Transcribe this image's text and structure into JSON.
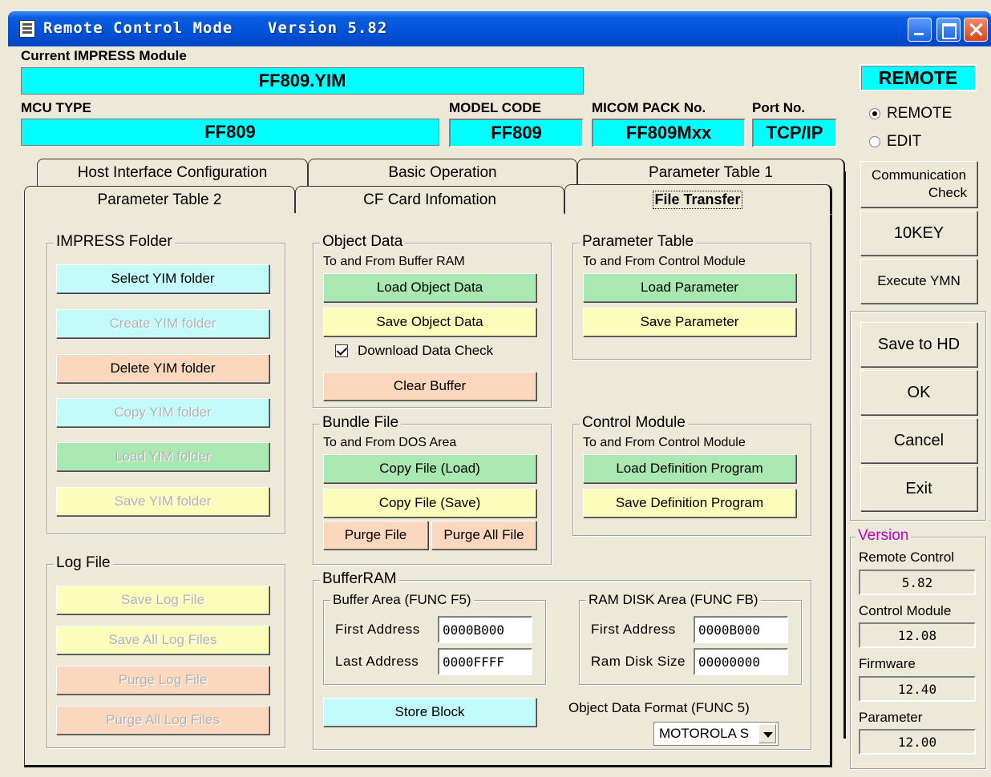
{
  "window": {
    "title": "Remote Control Mode",
    "version_label": "Version  5.82"
  },
  "module": {
    "label": "Current IMPRESS Module",
    "value": "FF809.YIM"
  },
  "mcu": {
    "label": "MCU TYPE",
    "value": "FF809"
  },
  "model": {
    "label": "MODEL CODE",
    "value": "FF809"
  },
  "micom": {
    "label": "MICOM PACK No.",
    "value": "FF809Mxx"
  },
  "port": {
    "label": "Port No.",
    "value": "TCP/IP"
  },
  "mode": {
    "badge": "REMOTE",
    "options": [
      "REMOTE",
      "EDIT"
    ],
    "selected": "REMOTE"
  },
  "tabs": {
    "row1": [
      "Host Interface Configuration",
      "Basic Operation",
      "Parameter Table 1"
    ],
    "row2": [
      "Parameter Table 2",
      "CF Card Infomation",
      "File Transfer"
    ],
    "active": "File Transfer"
  },
  "impress_folder": {
    "title": "IMPRESS Folder",
    "buttons": [
      "Select YIM folder",
      "Create YIM folder",
      "Delete YIM folder",
      "Copy YIM folder",
      "Load YIM folder",
      "Save YIM folder"
    ]
  },
  "log_file": {
    "title": "Log File",
    "buttons": [
      "Save Log File",
      "Save All Log Files",
      "Purge Log File",
      "Purge All Log Files"
    ]
  },
  "object_data": {
    "title": "Object Data",
    "subtitle": "To and From Buffer RAM",
    "load": "Load Object Data",
    "save": "Save Object Data",
    "check_label": "Download Data Check",
    "clear": "Clear Buffer"
  },
  "parameter_table": {
    "title": "Parameter Table",
    "subtitle": "To and From Control Module",
    "load": "Load Parameter",
    "save": "Save Parameter"
  },
  "bundle_file": {
    "title": "Bundle File",
    "subtitle": "To and From DOS Area",
    "copy_load": "Copy File (Load)",
    "copy_save": "Copy File (Save)",
    "purge": "Purge File",
    "purge_all": "Purge All File"
  },
  "control_module": {
    "title": "Control Module",
    "subtitle": "To and From Control Module",
    "load": "Load Definition Program",
    "save": "Save Definition Program"
  },
  "buffer_ram": {
    "title": "BufferRAM",
    "buffer_area": {
      "title": "Buffer Area (FUNC F5)",
      "first_label": "First  Address",
      "first_value": "0000B000",
      "last_label": "Last  Address",
      "last_value": "0000FFFF"
    },
    "ram_disk": {
      "title": "RAM DISK Area (FUNC FB)",
      "first_label": "First  Address",
      "first_value": "0000B000",
      "size_label": "Ram Disk Size",
      "size_value": "00000000"
    },
    "store": "Store Block",
    "format_label": "Object Data Format (FUNC 5)",
    "format_value": "MOTOROLA S"
  },
  "side_buttons": {
    "comm_check_line1": "Communication",
    "comm_check_line2": "Check",
    "tenkey": "10KEY",
    "execute": "Execute YMN",
    "save_hd": "Save to HD",
    "ok": "OK",
    "cancel": "Cancel",
    "exit": "Exit"
  },
  "version": {
    "title": "Version",
    "remote_label": "Remote Control",
    "remote_value": "5.82",
    "control_label": "Control Module",
    "control_value": "12.08",
    "firmware_label": "Firmware",
    "firmware_value": "12.40",
    "parameter_label": "Parameter",
    "parameter_value": "12.00"
  },
  "colors": {
    "cyan_field": "#00ffff",
    "btn_cyan": "#c3fbfb",
    "btn_green": "#a9e8b0",
    "btn_yellow": "#fcfcbb",
    "btn_peach": "#fbd7be",
    "version_title": "#c000c0"
  }
}
